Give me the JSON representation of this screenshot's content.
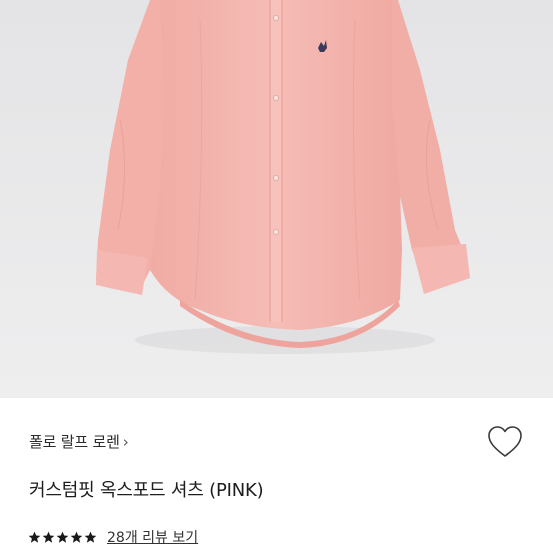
{
  "product": {
    "brand_link": "폴로 랄프 로렌",
    "brand_chevron": "›",
    "name": "커스텀핏 옥스포드 셔츠 (PINK)",
    "rating_stars": 5,
    "reviews_link": "28개 리뷰 보기"
  },
  "icons": {
    "wishlist": "heart-outline-icon",
    "star": "star-icon",
    "brand_chevron": "chevron-right-icon"
  },
  "colors": {
    "shirt": "#f4b4ae",
    "photo_background": "#e9e9ea",
    "logo": "#3a3a5a"
  }
}
